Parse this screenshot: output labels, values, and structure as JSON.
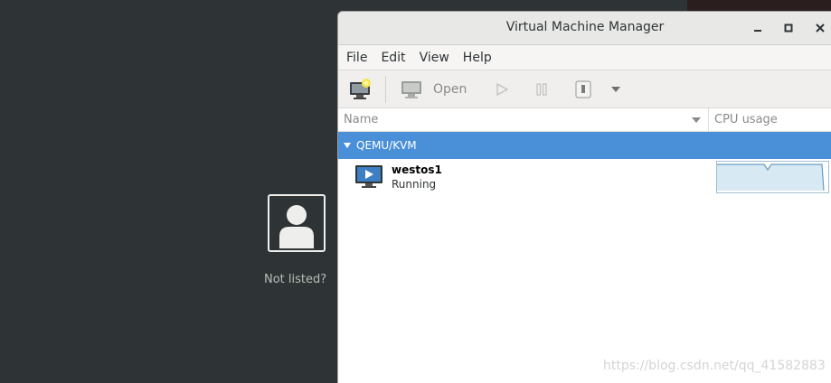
{
  "login": {
    "not_listed": "Not listed?"
  },
  "window": {
    "title": "Virtual Machine Manager",
    "controls": {
      "minimize": "‒",
      "maximize": "□",
      "close": "✕"
    }
  },
  "menubar": {
    "items": [
      {
        "label": "File"
      },
      {
        "label": "Edit"
      },
      {
        "label": "View"
      },
      {
        "label": "Help"
      }
    ]
  },
  "toolbar": {
    "open_label": "Open"
  },
  "columns": {
    "name": "Name",
    "cpu": "CPU usage"
  },
  "connection": {
    "label": "QEMU/KVM"
  },
  "vm": {
    "name": "westos1",
    "status": "Running"
  },
  "colors": {
    "selection": "#4a90d9",
    "desktop": "#2e3436",
    "graph_line": "#6a9cc0",
    "graph_fill": "#d7eaf3"
  },
  "watermark": "https://blog.csdn.net/qq_41582883"
}
